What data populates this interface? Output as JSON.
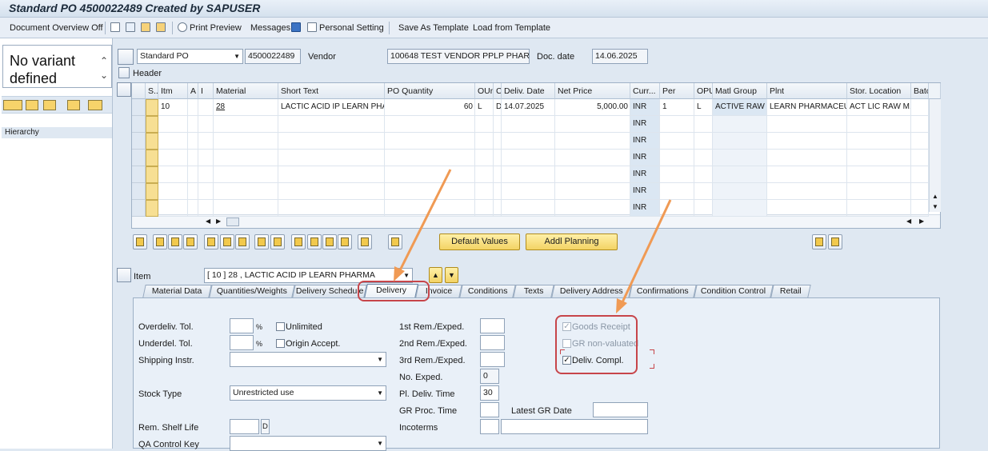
{
  "title": "Standard PO 4500022489 Created by SAPUSER",
  "toolbar": {
    "doc_overview": "Document Overview Off",
    "print_preview": "Print Preview",
    "messages": "Messages",
    "personal_setting": "Personal Setting",
    "save_template": "Save As Template",
    "load_template": "Load from Template"
  },
  "left": {
    "variant": "No variant defined",
    "hierarchy": "Hierarchy"
  },
  "header": {
    "doc_type": "Standard PO",
    "po_number": "4500022489",
    "vendor_label": "Vendor",
    "vendor_value": "100648 TEST VENDOR PPLP PHARMA",
    "doc_date_label": "Doc. date",
    "doc_date_value": "14.06.2025",
    "header_label": "Header"
  },
  "grid": {
    "columns": [
      "S..",
      "Itm",
      "A",
      "I",
      "Material",
      "Short Text",
      "PO Quantity",
      "OUn",
      "C",
      "Deliv. Date",
      "Net Price",
      "Curr...",
      "Per",
      "OPU",
      "Matl Group",
      "Plnt",
      "Stor. Location",
      "Batc"
    ],
    "row1": {
      "itm": "10",
      "material": "28",
      "short_text": "LACTIC ACID IP LEARN PHA...",
      "qty": "60",
      "oun": "L",
      "c": "D",
      "deliv_date": "14.07.2025",
      "net_price": "5,000.00",
      "curr": "INR",
      "per": "1",
      "opu": "L",
      "matl_group": "ACTIVE RAW ...",
      "plnt": "LEARN PHARMACEUT...",
      "stor_loc": "ACT LIC RAW M..."
    },
    "empty_curr": "INR"
  },
  "buttons": {
    "default_values": "Default Values",
    "addl_planning": "Addl Planning"
  },
  "item": {
    "label": "Item",
    "value": "[ 10 ] 28 , LACTIC ACID IP LEARN PHARMA"
  },
  "tabs": [
    "Material Data",
    "Quantities/Weights",
    "Delivery Schedule",
    "Delivery",
    "Invoice",
    "Conditions",
    "Texts",
    "Delivery Address",
    "Confirmations",
    "Condition Control",
    "Retail"
  ],
  "delivery": {
    "overdeliv_tol": "Overdeliv. Tol.",
    "underdel_tol": "Underdel. Tol.",
    "percent": "%",
    "unlimited": "Unlimited",
    "origin_accept": "Origin Accept.",
    "shipping_instr": "Shipping Instr.",
    "stock_type": "Stock Type",
    "stock_type_value": "Unrestricted use",
    "rem_shelf_life": "Rem. Shelf Life",
    "shelf_unit": "D",
    "qa_control_key": "QA Control Key",
    "rem1": "1st Rem./Exped.",
    "rem2": "2nd Rem./Exped.",
    "rem3": "3rd Rem./Exped.",
    "no_exped": "No. Exped.",
    "no_exped_value": "0",
    "pl_deliv_time": "Pl. Deliv. Time",
    "pl_deliv_value": "30",
    "gr_proc_time": "GR Proc. Time",
    "latest_gr_date": "Latest GR Date",
    "incoterms": "Incoterms",
    "goods_receipt": "Goods Receipt",
    "gr_non_valuated": "GR non-valuated",
    "deliv_compl": "Deliv. Compl.",
    "check_mark": "✓"
  },
  "colors": {
    "annotation_arrow": "#f09a54",
    "annotation_box": "#c7454a"
  }
}
